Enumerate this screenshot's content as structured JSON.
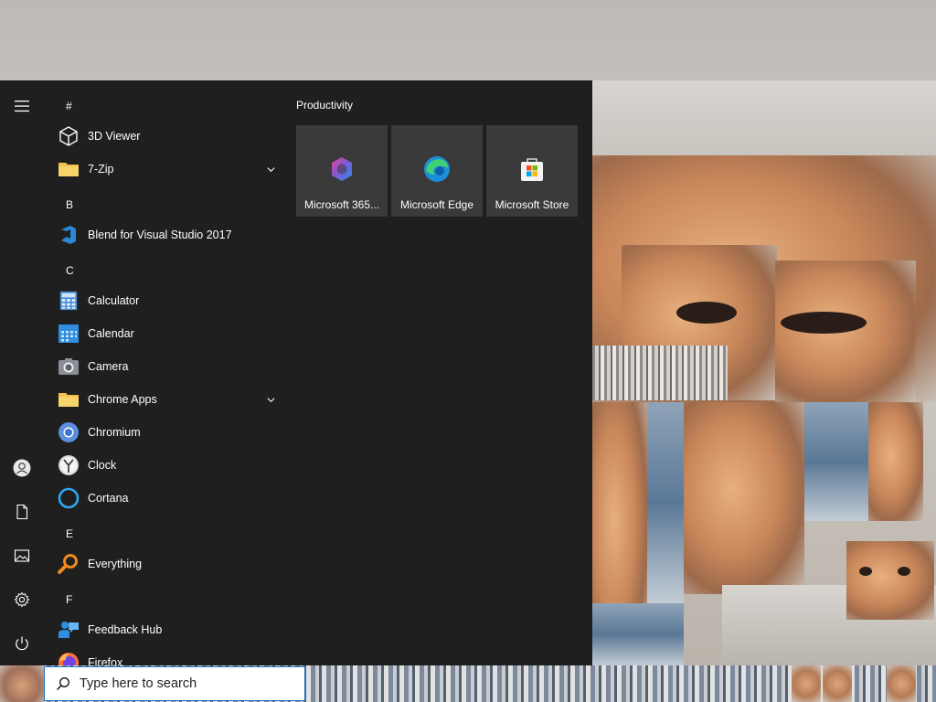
{
  "start_menu": {
    "rail": {
      "menu_icon": "hamburger-icon",
      "items": [
        {
          "name": "user-account-button",
          "icon": "user-icon"
        },
        {
          "name": "documents-button",
          "icon": "document-icon"
        },
        {
          "name": "pictures-button",
          "icon": "pictures-icon"
        },
        {
          "name": "settings-button",
          "icon": "gear-icon"
        },
        {
          "name": "power-button",
          "icon": "power-icon"
        }
      ]
    },
    "app_list": {
      "headers": {
        "hash": "#",
        "b": "B",
        "c": "C",
        "e": "E",
        "f": "F"
      },
      "apps": {
        "viewer3d": {
          "label": "3D Viewer",
          "icon": "cube-icon"
        },
        "zip7": {
          "label": "7-Zip",
          "icon": "folder-icon",
          "expandable": true
        },
        "blend": {
          "label": "Blend for Visual Studio 2017",
          "icon": "blend-icon"
        },
        "calculator": {
          "label": "Calculator",
          "icon": "calculator-icon"
        },
        "calendar": {
          "label": "Calendar",
          "icon": "calendar-icon"
        },
        "camera": {
          "label": "Camera",
          "icon": "camera-icon"
        },
        "chrome_apps": {
          "label": "Chrome Apps",
          "icon": "folder-icon",
          "expandable": true
        },
        "chromium": {
          "label": "Chromium",
          "icon": "chromium-icon"
        },
        "clock": {
          "label": "Clock",
          "icon": "clock-icon"
        },
        "cortana": {
          "label": "Cortana",
          "icon": "cortana-icon"
        },
        "everything": {
          "label": "Everything",
          "icon": "magnifier-icon"
        },
        "feedback": {
          "label": "Feedback Hub",
          "icon": "feedback-icon"
        },
        "firefox": {
          "label": "Firefox",
          "icon": "firefox-icon"
        }
      }
    },
    "tiles": {
      "group_title": "Productivity",
      "items": [
        {
          "label": "Microsoft 365...",
          "icon": "microsoft-365-icon"
        },
        {
          "label": "Microsoft Edge",
          "icon": "edge-icon"
        },
        {
          "label": "Microsoft Store",
          "icon": "store-icon"
        }
      ]
    }
  },
  "taskbar": {
    "search_placeholder": "Type here to search",
    "search_icon": "search-icon"
  },
  "colors": {
    "menu_bg": "#1f1f1f",
    "tile_bg": "#3a3a3a",
    "accent": "#1a6fc9"
  }
}
